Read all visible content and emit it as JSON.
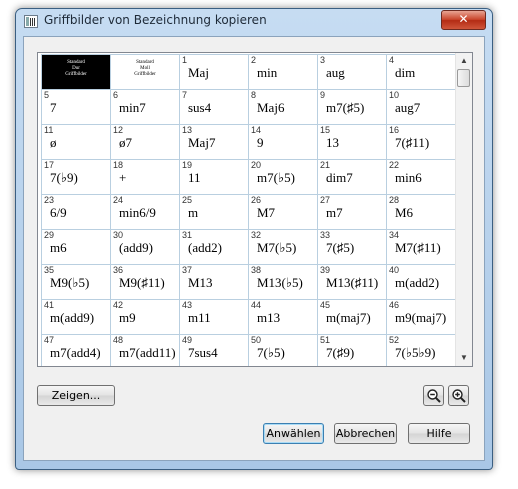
{
  "window": {
    "title": "Griffbilder von Bezeichnung kopieren",
    "close_symbol": "✕"
  },
  "grid": {
    "standard_cells": [
      {
        "lines": [
          "Standard",
          "Dur",
          "Griffbilder"
        ],
        "selected": true
      },
      {
        "lines": [
          "Standard",
          "Moll",
          "Griffbilder"
        ],
        "selected": false
      }
    ],
    "chords": [
      {
        "num": "1",
        "sym": "Maj"
      },
      {
        "num": "2",
        "sym": "min"
      },
      {
        "num": "3",
        "sym": "aug"
      },
      {
        "num": "4",
        "sym": "dim"
      },
      {
        "num": "5",
        "sym": "7"
      },
      {
        "num": "6",
        "sym": "min7"
      },
      {
        "num": "7",
        "sym": "sus4"
      },
      {
        "num": "8",
        "sym": "Maj6"
      },
      {
        "num": "9",
        "sym": "m7(♯5)"
      },
      {
        "num": "10",
        "sym": "aug7"
      },
      {
        "num": "11",
        "sym": "ø"
      },
      {
        "num": "12",
        "sym": "ø7"
      },
      {
        "num": "13",
        "sym": "Maj7"
      },
      {
        "num": "14",
        "sym": "9"
      },
      {
        "num": "15",
        "sym": "13"
      },
      {
        "num": "16",
        "sym": "7(♯11)"
      },
      {
        "num": "17",
        "sym": "7(♭9)"
      },
      {
        "num": "18",
        "sym": "+"
      },
      {
        "num": "19",
        "sym": "11"
      },
      {
        "num": "20",
        "sym": "m7(♭5)"
      },
      {
        "num": "21",
        "sym": "dim7"
      },
      {
        "num": "22",
        "sym": "min6"
      },
      {
        "num": "23",
        "sym": "6/9"
      },
      {
        "num": "24",
        "sym": "min6/9"
      },
      {
        "num": "25",
        "sym": "m"
      },
      {
        "num": "26",
        "sym": "M7"
      },
      {
        "num": "27",
        "sym": "m7"
      },
      {
        "num": "28",
        "sym": "M6"
      },
      {
        "num": "29",
        "sym": "m6"
      },
      {
        "num": "30",
        "sym": "(add9)"
      },
      {
        "num": "31",
        "sym": "(add2)"
      },
      {
        "num": "32",
        "sym": "M7(♭5)"
      },
      {
        "num": "33",
        "sym": "7(♯5)"
      },
      {
        "num": "34",
        "sym": "M7(♯11)"
      },
      {
        "num": "35",
        "sym": "M9(♭5)"
      },
      {
        "num": "36",
        "sym": "M9(♯11)"
      },
      {
        "num": "37",
        "sym": "M13"
      },
      {
        "num": "38",
        "sym": "M13(♭5)"
      },
      {
        "num": "39",
        "sym": "M13(♯11)"
      },
      {
        "num": "40",
        "sym": "m(add2)"
      },
      {
        "num": "41",
        "sym": "m(add9)"
      },
      {
        "num": "42",
        "sym": "m9"
      },
      {
        "num": "43",
        "sym": "m11"
      },
      {
        "num": "44",
        "sym": "m13"
      },
      {
        "num": "45",
        "sym": "m(maj7)"
      },
      {
        "num": "46",
        "sym": "m9(maj7)"
      },
      {
        "num": "47",
        "sym": "m7(add4)"
      },
      {
        "num": "48",
        "sym": "m7(add11)"
      },
      {
        "num": "49",
        "sym": "7sus4"
      },
      {
        "num": "50",
        "sym": "7(♭5)"
      },
      {
        "num": "51",
        "sym": "7(♯9)"
      },
      {
        "num": "52",
        "sym": "7(♭5♭9)"
      }
    ]
  },
  "buttons": {
    "show": "Zeigen...",
    "apply": "Anwählen",
    "cancel": "Abbrechen",
    "help": "Hilfe"
  },
  "icons": {
    "zoom_out": "zoom-out-icon",
    "zoom_in": "zoom-in-icon",
    "scroll_up": "▲",
    "scroll_down": "▼"
  }
}
